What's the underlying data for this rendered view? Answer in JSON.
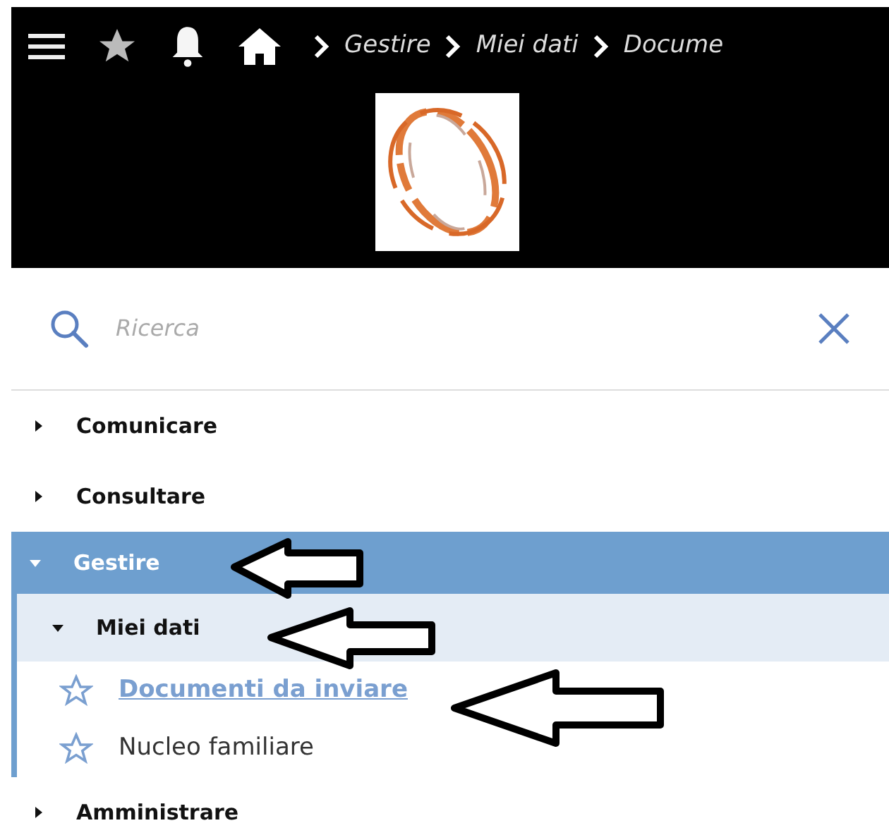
{
  "breadcrumb": [
    "Gestire",
    "Miei dati",
    "Docume"
  ],
  "search": {
    "placeholder": "Ricerca"
  },
  "menu": [
    {
      "label": "Comunicare",
      "expanded": false,
      "selected": false
    },
    {
      "label": "Consultare",
      "expanded": false,
      "selected": false
    },
    {
      "label": "Gestire",
      "expanded": true,
      "selected": true,
      "children": [
        {
          "label": "Miei dati",
          "expanded": true,
          "selected": true,
          "children": [
            {
              "label": "Documenti da inviare",
              "selected": true
            },
            {
              "label": "Nucleo familiare",
              "selected": false
            }
          ]
        }
      ]
    },
    {
      "label": "Amministrare",
      "expanded": false,
      "selected": false
    }
  ]
}
